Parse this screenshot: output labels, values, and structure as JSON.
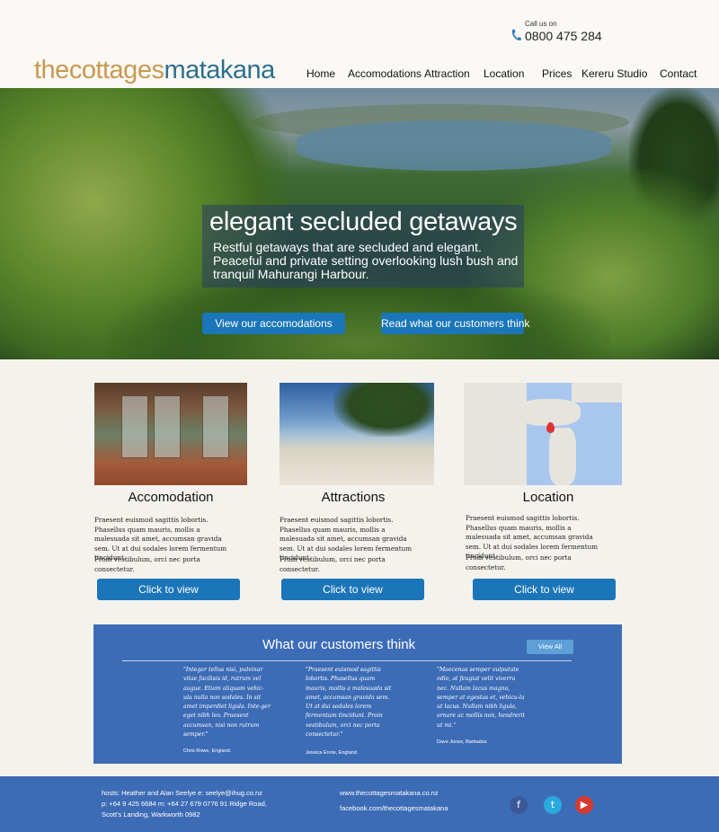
{
  "header": {
    "call_label": "Call us on",
    "phone": "0800 475 284",
    "logo_part1": "thecottages",
    "logo_part2": "matakana"
  },
  "nav": [
    {
      "label": "Home"
    },
    {
      "label": "Accomodations"
    },
    {
      "label": "Attraction"
    },
    {
      "label": "Location"
    },
    {
      "label": "Prices"
    },
    {
      "label": "Kereru Studio"
    },
    {
      "label": "Contact"
    }
  ],
  "hero": {
    "title": "elegant secluded getaways",
    "subtitle": "Restful getaways that are secluded and elegant. Peaceful and private setting overlooking lush bush and tranquil Mahurangi Harbour.",
    "btn_accommodations": "View our accomodations",
    "btn_reviews": "Read what our customers think"
  },
  "cards": [
    {
      "title": "Accomodation",
      "text": "Praesent euismod sagittis lobortis. Phasellus quam mauris, mollis a malesuada sit amet, accumsan gravida sem. Ut at dui sodales lorem fermentum tincidunt.",
      "text2": "Proin vestibulum, orci nec porta consectetur.",
      "button": "Click to view"
    },
    {
      "title": "Attractions",
      "text": "Praesent euismod sagittis lobortis. Phasellus quam mauris, mollis a malesuada sit amet, accumsan gravida sem. Ut at dui sodales lorem fermentum tincidunt.",
      "text2": "Proin vestibulum, orci nec porta consectetur.",
      "button": "Click to view"
    },
    {
      "title": "Location",
      "text": "Praesent euismod sagittis lobortis. Phasellus quam mauris, mollis a malesuada sit amet, accumsan gravida sem. Ut at dui sodales lorem fermentum tincidunt.",
      "text2": "Proin vestibulum, orci nec porta consectetur.",
      "button": "Click to view"
    }
  ],
  "testimonials": {
    "title": "What our customers think",
    "view_all": "View All",
    "items": [
      {
        "quote": "\"Integer tellus nisi, pulvinar vitae facilisis id, rutrum vel augue. Etiam aliquam vehic-ula nulla non sodales. In sit amet imperdiet ligula. Inte-ger eget nibh leo. Praesent accumsan, nisi non rutrum semper.\"",
        "author": "Chris Rowe, England."
      },
      {
        "quote": "\"Praesent euismod sagittis lobortis. Phasellus quam mauris, mollis a malesuada sit amet, accumsan gravida sem. Ut at dui sodales lorem fermentum tincidunt. Proin vestibulum, orci nec porta consectetur.\"",
        "author": "Jessica Ennis, England."
      },
      {
        "quote": "\"Maecenas semper vulputate odio, at feugiat velit viverra nec. Nullam lacus magna, semper at egestas et, vehicu-la ut lacus. Nullam nibh ligula, ornare ac mollis non, hendrerit ut mi.\"",
        "author": "Dave Jones, Barbados"
      }
    ]
  },
  "footer": {
    "hosts_line1": "hosts: Heather and Alan Seelye e: seelye@ihug.co.nz",
    "hosts_line2": "p: +64 9 425 6684      m: +64 27 679 0776 91 Ridge Road,",
    "hosts_line3": "Scott's Landing, Warkworth 0982",
    "website": "www.thecottagesmatakana.co.nz",
    "facebook": "facebook.com/thecottagesmatakana",
    "social": [
      {
        "icon": "facebook-icon",
        "glyph": "f",
        "color": "#3b5998"
      },
      {
        "icon": "twitter-icon",
        "glyph": "t",
        "color": "#2aa9e0"
      },
      {
        "icon": "youtube-icon",
        "glyph": "▶",
        "color": "#d63b2f"
      }
    ]
  },
  "colors": {
    "accent_blue": "#1a76b8",
    "section_blue": "#3d6cb6",
    "logo_gold": "#c8994e",
    "logo_teal": "#2d6f8c"
  }
}
